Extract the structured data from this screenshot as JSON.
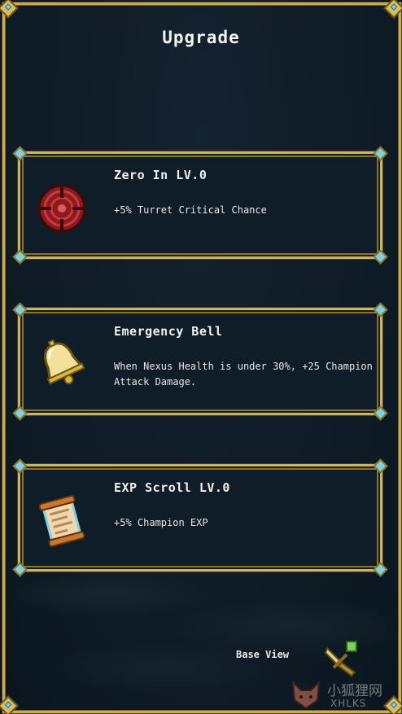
{
  "screen": {
    "title": "Upgrade"
  },
  "cards": [
    {
      "name": "Zero In LV.0",
      "description": "+5% Turret Critical Chance",
      "icon": "crosshair-target-icon"
    },
    {
      "name": "Emergency Bell",
      "description": "When Nexus Health is under 30%, +25 Champion Attack Damage.",
      "icon": "bell-icon"
    },
    {
      "name": "EXP Scroll LV.0",
      "description": "+5% Champion EXP",
      "icon": "scroll-icon"
    }
  ],
  "footer": {
    "base_view_label": "Base View",
    "base_view_icon": "sword-icon"
  },
  "watermark": {
    "text": "小狐狸网",
    "sub": "XHLKS"
  },
  "colors": {
    "background": "#0f1b26",
    "gold_border": "#cdb463",
    "gem": "#7fd0e0",
    "text": "#f0f0f0"
  }
}
